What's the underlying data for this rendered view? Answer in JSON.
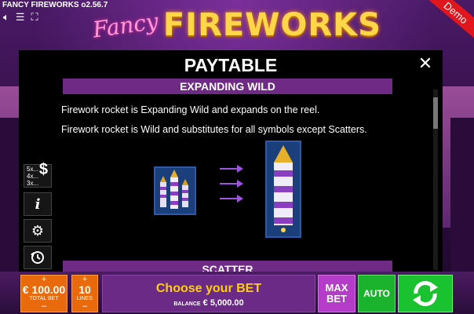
{
  "game": {
    "version_label": "FANCY FIREWORKS o2.56.7",
    "logo_fancy": "Fancy",
    "logo_fireworks": "FIREWORKS",
    "demo_label": "Demo"
  },
  "paytable": {
    "title": "PAYTABLE",
    "section_expanding": "EXPANDING WILD",
    "desc1": "Firework rocket is Expanding Wild and expands on the reel.",
    "desc2": "Firework rocket is Wild and substitutes for all symbols except Scatters.",
    "section_next": "SCATTER"
  },
  "side": {
    "paytable_rows": [
      "5x...",
      "4x...",
      "3x..."
    ],
    "paytable_symbol": "$"
  },
  "bottom": {
    "total_bet_value": "€ 100.00",
    "total_bet_label": "TOTAL BET",
    "lines_value": "10",
    "lines_label": "LINES",
    "plus": "+",
    "minus": "–",
    "message": "Choose your BET",
    "balance_label": "BALANCE",
    "balance_value": "€ 5,000.00",
    "maxbet_label": "MAX BET",
    "auto_label": "AUTO"
  },
  "colors": {
    "section_bar": "#6f2a86",
    "stepper": "#e86a0c",
    "maxbet": "#b43cc8",
    "auto": "#1bb32e",
    "message": "#ffd000"
  }
}
